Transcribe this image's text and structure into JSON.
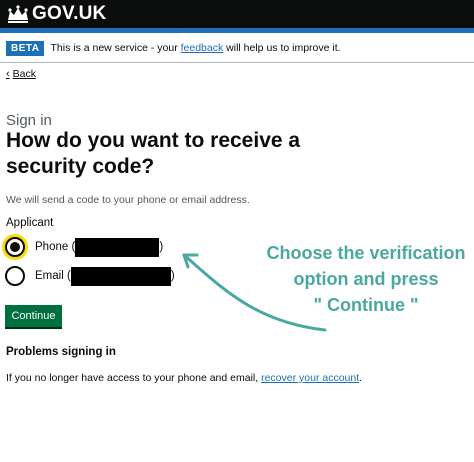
{
  "header": {
    "logo_text": "GOV.UK"
  },
  "beta_banner": {
    "tag": "BETA",
    "text_before": "This is a new service - your",
    "link": "feedback",
    "text_after": "will help us to improve it."
  },
  "back_link": {
    "label": "Back"
  },
  "caption": "Sign in",
  "heading": "How do you want to receive a security code?",
  "hint": "We will send a code to your phone or email address.",
  "fieldset": {
    "legend": "Applicant",
    "options": [
      {
        "label": "Phone",
        "open": "(",
        "close": ")",
        "selected": true
      },
      {
        "label": "Email",
        "open": "(",
        "close": ")",
        "selected": false
      }
    ]
  },
  "continue_button": {
    "label": "Continue"
  },
  "problems": {
    "title": "Problems signing in",
    "text": "If you no longer have access to your phone and email,",
    "link": "recover your account",
    "after": "."
  },
  "annotation": {
    "lines": [
      "Choose the verification",
      "option and press",
      "\" Continue \""
    ],
    "color": "#4aa8a0"
  },
  "colors": {
    "header_bg": "#0b0c0c",
    "brand_blue": "#1d70b8",
    "button_green": "#00703c",
    "focus_yellow": "#ffdd00"
  }
}
